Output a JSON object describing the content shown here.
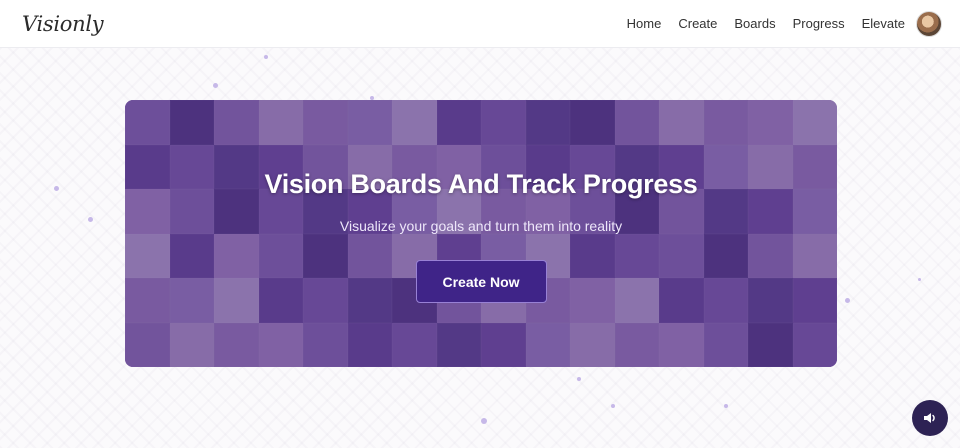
{
  "brand": {
    "logo_text": "Visionly"
  },
  "nav": {
    "items": [
      {
        "label": "Home"
      },
      {
        "label": "Create"
      },
      {
        "label": "Boards"
      },
      {
        "label": "Progress"
      },
      {
        "label": "Elevate"
      }
    ]
  },
  "hero": {
    "title": "Vision Boards And Track Progress",
    "subtitle": "Visualize your goals and turn them into reality",
    "cta_label": "Create Now"
  },
  "icons": {
    "avatar": "user-avatar-photo",
    "audio": "speaker-icon"
  },
  "colors": {
    "accent": "#3f2488",
    "hero_overlay": "#4c2c80",
    "audio_button": "#2d2254"
  }
}
